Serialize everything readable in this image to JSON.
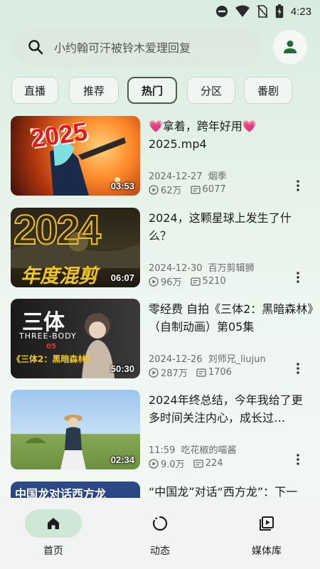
{
  "status_bar": {
    "time": "4:23",
    "icons": [
      "do-not-disturb-icon",
      "wifi-icon",
      "no-sim-icon",
      "battery-charging-icon"
    ]
  },
  "search": {
    "placeholder": "小约翰可汗被铃木爱理回复",
    "icon": "search-icon"
  },
  "profile": {
    "icon": "person-icon"
  },
  "tabs": [
    {
      "label": "直播",
      "active": false
    },
    {
      "label": "推荐",
      "active": false
    },
    {
      "label": "热门",
      "active": true
    },
    {
      "label": "分区",
      "active": false
    },
    {
      "label": "番剧",
      "active": false
    }
  ],
  "videos": [
    {
      "title": "💗拿着，跨年好用💗2025.mp4",
      "date": "2024-12-27",
      "author": "烟季",
      "views": "62万",
      "danmaku": "6077",
      "duration": "03:53",
      "thumb_text": "2025"
    },
    {
      "title": "2024，这颗星球上发生了什么？",
      "date": "2024-12-30",
      "author": "百万剪辑狮",
      "views": "96万",
      "danmaku": "5210",
      "duration": "06:07",
      "thumb_text": "2024",
      "thumb_sub": "年度混剪"
    },
    {
      "title": "零经费 自拍《三体2：黑暗森林》（自制动画）第05集",
      "date": "2024-12-26",
      "author": "刘师兄_liujun",
      "views": "287万",
      "danmaku": "1706",
      "duration": "50:30",
      "thumb_text": "三体",
      "thumb_en": "THREE-BODY",
      "thumb_num": "05",
      "thumb_sub": "《三体2：黑暗森林》"
    },
    {
      "title": "2024年终总结，今年我给了更多时间关注内心，成长过…",
      "date": "11:59",
      "author": "吃花椒的喵酱",
      "views": "9.0万",
      "danmaku": "224",
      "duration": "02:34"
    },
    {
      "title": "“中国龙”对话“西方龙”：下一",
      "thumb_text": "中国龙对话西方龙"
    }
  ],
  "bottom_nav": [
    {
      "label": "首页",
      "icon": "home-icon",
      "active": true
    },
    {
      "label": "动态",
      "icon": "dynamic-icon",
      "active": false
    },
    {
      "label": "媒体库",
      "icon": "media-library-icon",
      "active": false
    }
  ],
  "colors": {
    "accent": "#1f6b3a",
    "tab_active_border": "#4a5a4f",
    "nav_active_pill": "#cfe7d6"
  }
}
